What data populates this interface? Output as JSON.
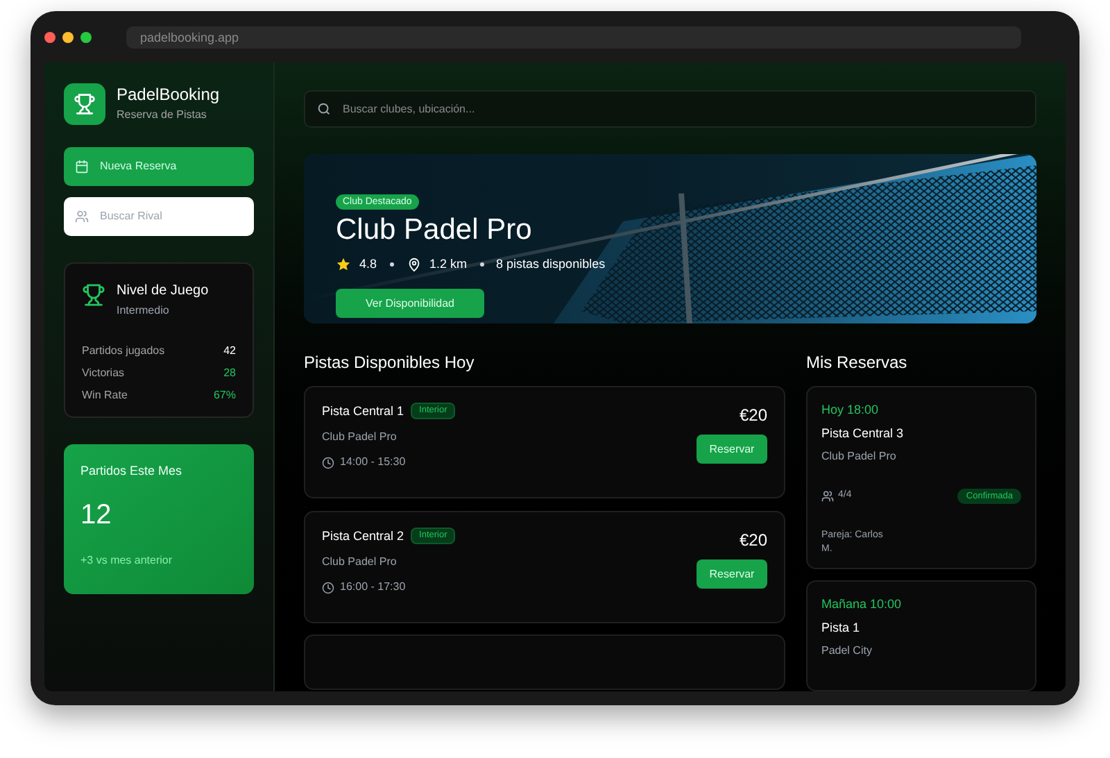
{
  "browser": {
    "url": "padelbooking.app"
  },
  "sidebar": {
    "brand": {
      "title": "PadelBooking",
      "subtitle": "Reserva de Pistas"
    },
    "actions": [
      {
        "label": "Nueva Reserva",
        "kind": "primary"
      },
      {
        "label": "Buscar Rival",
        "kind": "secondary"
      }
    ],
    "level_card": {
      "title": "Nivel de Juego",
      "value": "Intermedio",
      "stats": [
        {
          "label": "Partidos jugados",
          "value": "42",
          "highlight": false
        },
        {
          "label": "Victorias",
          "value": "28",
          "highlight": true
        },
        {
          "label": "Win Rate",
          "value": "67%",
          "highlight": true
        }
      ]
    },
    "month_card": {
      "title": "Partidos Este Mes",
      "value": "12",
      "delta": "+3 vs mes anterior"
    }
  },
  "search": {
    "placeholder": "Buscar clubes, ubicación..."
  },
  "hero": {
    "badge": "Club Destacado",
    "title": "Club Padel Pro",
    "rating": "4.8",
    "distance": "1.2 km",
    "courts": "8 pistas disponibles",
    "button": "Ver Disponibilidad"
  },
  "courts": {
    "title": "Pistas Disponibles Hoy",
    "items": [
      {
        "name": "Pista Central 1",
        "tag": "Interior",
        "club": "Club Padel Pro",
        "time": "14:00 - 15:30",
        "price": "€20",
        "button": "Reservar"
      },
      {
        "name": "Pista Central 2",
        "tag": "Interior",
        "club": "Club Padel Pro",
        "time": "16:00 - 17:30",
        "price": "€20",
        "button": "Reservar"
      }
    ]
  },
  "bookings": {
    "title": "Mis Reservas",
    "items": [
      {
        "when": "Hoy 18:00",
        "court": "Pista Central 3",
        "club": "Club Padel Pro",
        "players": "4/4",
        "status": "Confirmada",
        "partner": "Pareja: Carlos M."
      },
      {
        "when": "Mañana 10:00",
        "court": "Pista 1",
        "club": "Padel City"
      }
    ]
  }
}
